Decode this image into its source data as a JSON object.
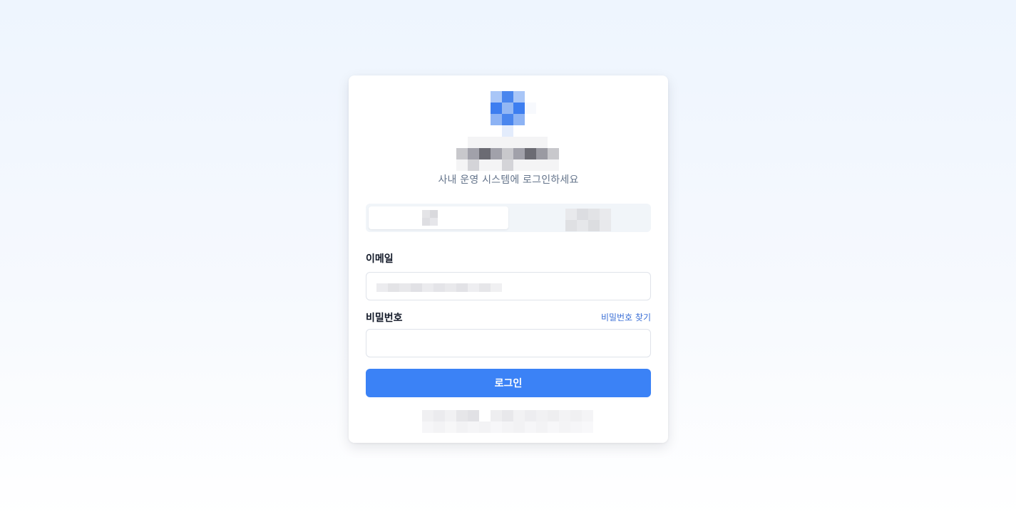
{
  "header": {
    "subtitle": "사내 운영 시스템에 로그인하세요"
  },
  "form": {
    "email_label": "이메일",
    "email_value": "",
    "password_label": "비밀번호",
    "password_value": "",
    "forgot_password": "비밀번호 찾기",
    "submit_label": "로그인"
  },
  "colors": {
    "accent": "#3b82f6",
    "link": "#3b6fd6",
    "subtitle": "#64748b",
    "tab_track": "#f1f5f9"
  }
}
